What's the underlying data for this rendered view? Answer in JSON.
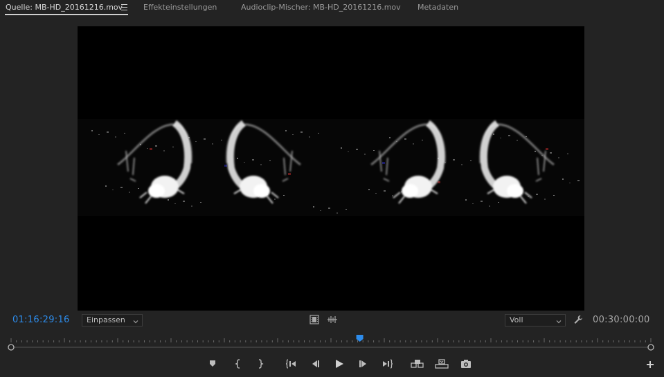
{
  "tabs": [
    {
      "label": "Quelle: MB-HD_20161216.mov",
      "active": true
    },
    {
      "label": "Effekteinstellungen",
      "active": false
    },
    {
      "label": "Audioclip-Mischer: MB-HD_20161216.mov",
      "active": false
    },
    {
      "label": "Metadaten",
      "active": false
    }
  ],
  "monitor": {
    "current_timecode": "01:16:29:16",
    "duration_timecode": "00:30:00:00",
    "zoom": {
      "value": "Einpassen"
    },
    "resolution": {
      "value": "Voll"
    },
    "playhead_fraction": 0.545
  },
  "icons": {
    "settings": "wrench-icon",
    "drag_video": "film-strip-icon",
    "drag_audio": "audio-waveform-icon",
    "add": "plus-icon"
  },
  "transport": [
    "marker-icon",
    "mark-in-icon",
    "mark-out-icon",
    "go-to-in-icon",
    "step-back-icon",
    "play-icon",
    "step-forward-icon",
    "go-to-out-icon",
    "insert-icon",
    "overwrite-icon",
    "export-frame-icon"
  ],
  "colors": {
    "accent": "#2d8ceb",
    "panel_bg": "#232323",
    "video_bg": "#000000",
    "text": "#a9a9a9"
  }
}
